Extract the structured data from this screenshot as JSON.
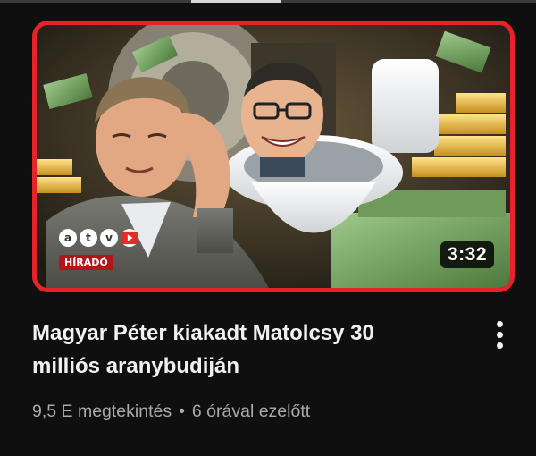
{
  "video": {
    "title": "Magyar Péter kiakadt Matolcsy 30 milliós aranybudiján",
    "duration": "3:32",
    "views": "9,5 E megtekintés",
    "separator": "•",
    "age": "6 órával ezelőtt"
  },
  "thumbnail": {
    "channel_letters": [
      "a",
      "t",
      "v"
    ],
    "tag": "HÍRADÓ",
    "border_color": "#e6222a"
  },
  "menu": {
    "icon": "more-vertical-icon"
  }
}
